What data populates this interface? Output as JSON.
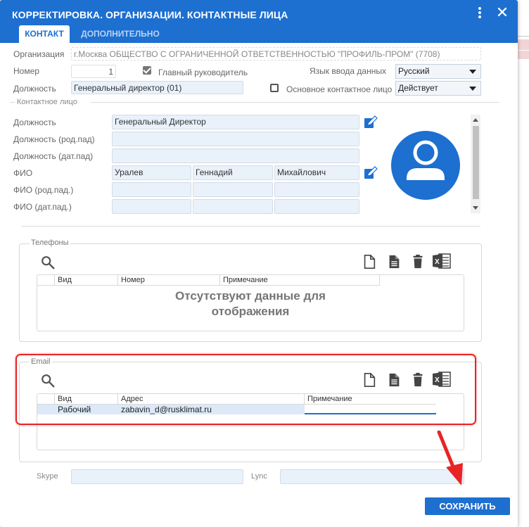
{
  "window": {
    "title": "КОРРЕКТИРОВКА. ОРГАНИЗАЦИИ. КОНТАКТНЫЕ ЛИЦА",
    "menu_icon": "kebab-menu-icon",
    "close_icon": "close-icon",
    "close_glyph": "✕"
  },
  "tabs": [
    {
      "label": "КОНТАКТ",
      "active": true
    },
    {
      "label": "ДОПОЛНИТЕЛЬНО",
      "active": false
    }
  ],
  "form": {
    "org_label": "Организация",
    "org_value": "г.Москва ОБЩЕСТВО С ОГРАНИЧЕННОЙ ОТВЕТСТВЕННОСТЬЮ \"ПРОФИЛЬ-ПРОМ\" (7708)",
    "number_label": "Номер",
    "number_value": "1",
    "head_checkbox_label": "Главный руководитель",
    "head_checked": true,
    "lang_label": "Язык ввода данных",
    "lang_value": "Русский",
    "position_label": "Должность",
    "position_value": "Генеральный директор (01)",
    "main_contact_label": "Основное контактное лицо",
    "main_contact_checked": false,
    "status_value": "Действует"
  },
  "contact": {
    "section_label": "Контактное лицо",
    "position_label": "Должность",
    "position_value": "Генеральный Директор",
    "position_gen_label": "Должность (род.пад)",
    "position_gen_value": "",
    "position_dat_label": "Должность (дат.пад)",
    "position_dat_value": "",
    "fio_label": "ФИО",
    "surname": "Уралев",
    "name": "Геннадий",
    "patronymic": "Михайлович",
    "fio_gen_label": "ФИО  (род.пад.)",
    "fio_dat_label": "ФИО  (дат.пад.)",
    "avatar_icon": "user-avatar-icon"
  },
  "phones": {
    "legend": "Телефоны",
    "columns": [
      "Вид",
      "Номер",
      "Примечание"
    ],
    "empty_line1": "Отсутствуют данные для",
    "empty_line2": "отображения"
  },
  "emails": {
    "legend": "Email",
    "columns": [
      "Вид",
      "Адрес",
      "Примечание"
    ],
    "rows": [
      {
        "type": "Рабочий",
        "address": "zabavin_d@rusklimat.ru",
        "note": ""
      }
    ]
  },
  "footer": {
    "skype_label": "Skype",
    "skype_value": "",
    "lync_label": "Lync",
    "lync_value": "",
    "save_label": "СОХРАНИТЬ"
  },
  "colors": {
    "primary": "#1d6fd0",
    "highlight": "#e82424",
    "avatar": "#1d6fd0"
  }
}
